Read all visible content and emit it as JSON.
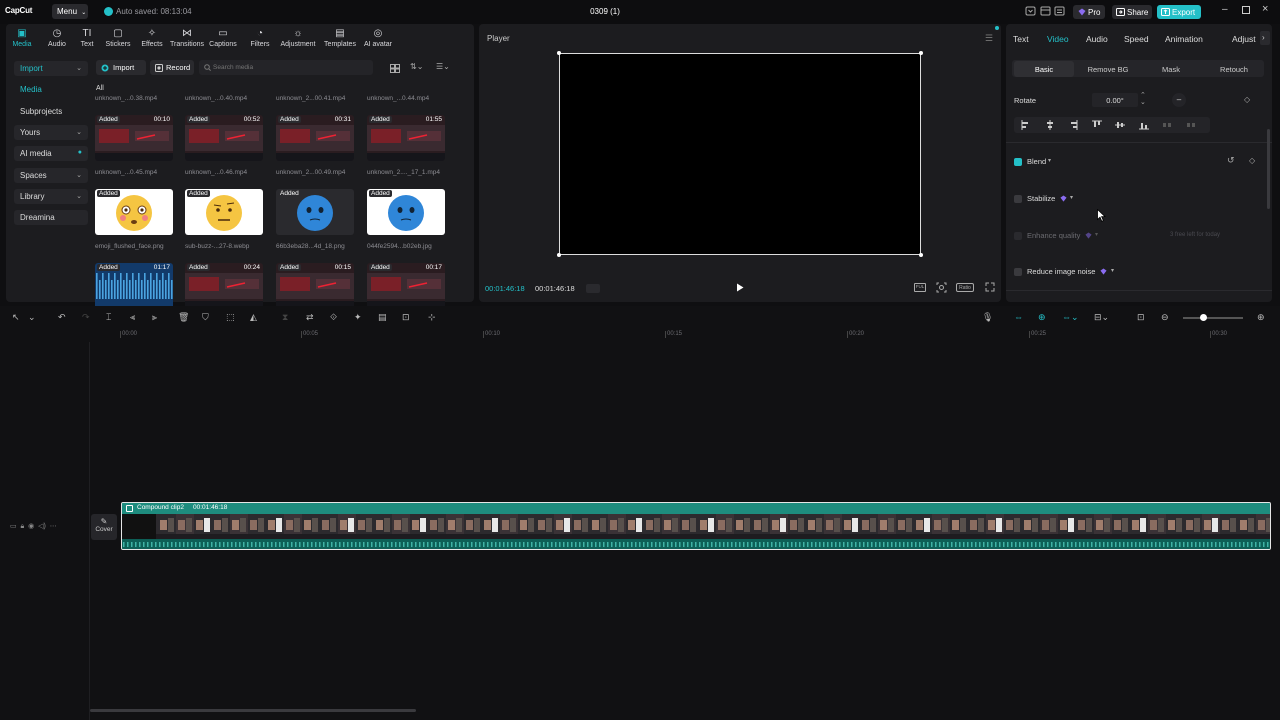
{
  "titlebar": {
    "logo": "CapCut",
    "menu_label": "Menu",
    "autosave": "Auto saved: 08:13:04",
    "project_title": "0309 (1)",
    "pro_label": "Pro",
    "share_label": "Share",
    "export_label": "Export"
  },
  "media_toolbar": [
    {
      "label": "Media",
      "icon": "media-icon"
    },
    {
      "label": "Audio",
      "icon": "audio-icon"
    },
    {
      "label": "Text",
      "icon": "text-icon"
    },
    {
      "label": "Stickers",
      "icon": "stickers-icon"
    },
    {
      "label": "Effects",
      "icon": "effects-icon"
    },
    {
      "label": "Transitions",
      "icon": "transitions-icon"
    },
    {
      "label": "Captions",
      "icon": "captions-icon"
    },
    {
      "label": "Filters",
      "icon": "filters-icon"
    },
    {
      "label": "Adjustment",
      "icon": "adjustment-icon"
    },
    {
      "label": "Templates",
      "icon": "templates-icon"
    },
    {
      "label": "AI avatar",
      "icon": "ai-avatar-icon"
    }
  ],
  "sidebar": {
    "items": [
      {
        "label": "Import"
      },
      {
        "label": "Media"
      },
      {
        "label": "Subprojects"
      },
      {
        "label": "Yours"
      },
      {
        "label": "AI media"
      },
      {
        "label": "Spaces"
      },
      {
        "label": "Library"
      },
      {
        "label": "Dreamina"
      }
    ]
  },
  "media_bar": {
    "import_label": "Import",
    "record_label": "Record",
    "search_placeholder": "Search media",
    "filter_all": "All"
  },
  "media_top_captions": [
    "unknown_...0.38.mp4",
    "unknown_...0.40.mp4",
    "unknown_2...00.41.mp4",
    "unknown_...0.44.mp4"
  ],
  "media_rows": [
    [
      {
        "added": "Added",
        "duration": "00:10",
        "caption": "unknown_...0.45.mp4",
        "kind": "video"
      },
      {
        "added": "Added",
        "duration": "00:52",
        "caption": "unknown_...0.46.mp4",
        "kind": "video"
      },
      {
        "added": "Added",
        "duration": "00:31",
        "caption": "unknown_2...00.49.mp4",
        "kind": "video"
      },
      {
        "added": "Added",
        "duration": "01:55",
        "caption": "unknown_2...._17_1.mp4",
        "kind": "video"
      }
    ],
    [
      {
        "added": "Added",
        "duration": "",
        "caption": "emoji_flushed_face.png",
        "kind": "emoji-flushed"
      },
      {
        "added": "Added",
        "duration": "",
        "caption": "sub-buzz-...27-8.webp",
        "kind": "emoji-raised"
      },
      {
        "added": "Added",
        "duration": "",
        "caption": "66b3eba28...4d_18.png",
        "kind": "emoji-blue-dark"
      },
      {
        "added": "Added",
        "duration": "",
        "caption": "044fe2594...b02eb.jpg",
        "kind": "emoji-blue"
      }
    ],
    [
      {
        "added": "Added",
        "duration": "01:17",
        "caption": "",
        "kind": "audio"
      },
      {
        "added": "Added",
        "duration": "00:24",
        "caption": "",
        "kind": "video"
      },
      {
        "added": "Added",
        "duration": "00:15",
        "caption": "",
        "kind": "video"
      },
      {
        "added": "Added",
        "duration": "00:17",
        "caption": "",
        "kind": "video"
      }
    ]
  ],
  "player": {
    "title": "Player",
    "current_time": "00:01:46:18",
    "total_time": "00:01:46:18",
    "ratio_label": "Ratio"
  },
  "props": {
    "tabs": [
      "Text",
      "Video",
      "Audio",
      "Speed",
      "Animation",
      "Adjust"
    ],
    "subtabs": [
      "Basic",
      "Remove BG",
      "Mask",
      "Retouch"
    ],
    "rotate_label": "Rotate",
    "rotate_value": "0.00°",
    "blend_label": "Blend",
    "stabilize_label": "Stabilize",
    "enhance_label": "Enhance quality",
    "enhance_note": "3 free left for today",
    "noise_label": "Reduce image noise"
  },
  "timeline": {
    "ticks": [
      "00:00",
      "00:05",
      "00:10",
      "00:15",
      "00:20",
      "00:25",
      "00:30"
    ],
    "clip_label": "Compound clip2",
    "clip_duration": "00:01:46:18",
    "cover_label": "Cover"
  },
  "colors": {
    "accent": "#24c0c8",
    "clip": "#1a7a6e"
  }
}
